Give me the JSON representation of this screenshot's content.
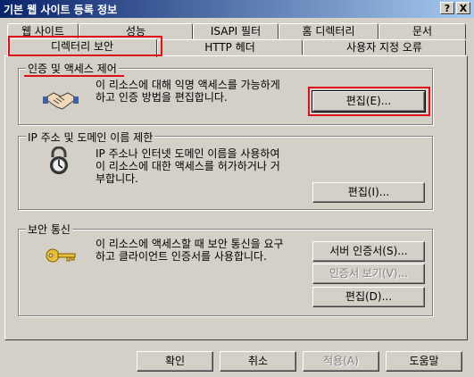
{
  "window": {
    "title": "기본 웹 사이트 등록 정보",
    "help_button": "?",
    "close_button": "X"
  },
  "tabs": {
    "row1": [
      "웹 사이트",
      "성능",
      "ISAPI 필터",
      "홈 디렉터리",
      "문서"
    ],
    "row2": [
      "디렉터리 보안",
      "HTTP 헤더",
      "사용자 지정 오류"
    ]
  },
  "auth": {
    "title": "인증 및 액세스 제어",
    "line1": "이 리소스에 대해 익명 액세스를 가능하게",
    "line2": "하고 인증 방법을 편집합니다.",
    "edit_button": "편집(E)..."
  },
  "ip": {
    "title": "IP 주소 및 도메인 이름 제한",
    "line1": "IP 주소나 인터넷 도메인 이름을 사용하여",
    "line2": "이 리소스에 대한 액세스를 허가하거나 거",
    "line3": "부합니다.",
    "edit_button": "편집(I)..."
  },
  "secure": {
    "title": "보안 통신",
    "line1": "이 리소스에 액세스할 때 보안 통신을 요구",
    "line2": "하고 클라이언트 인증서를 사용합니다.",
    "server_cert_button": "서버 인증서(S)...",
    "view_cert_button": "인증서 보기(V)...",
    "edit_button": "편집(D)..."
  },
  "footer": {
    "ok": "확인",
    "cancel": "취소",
    "apply": "적용(A)",
    "help": "도움말"
  },
  "highlight_color": "#e0101a"
}
